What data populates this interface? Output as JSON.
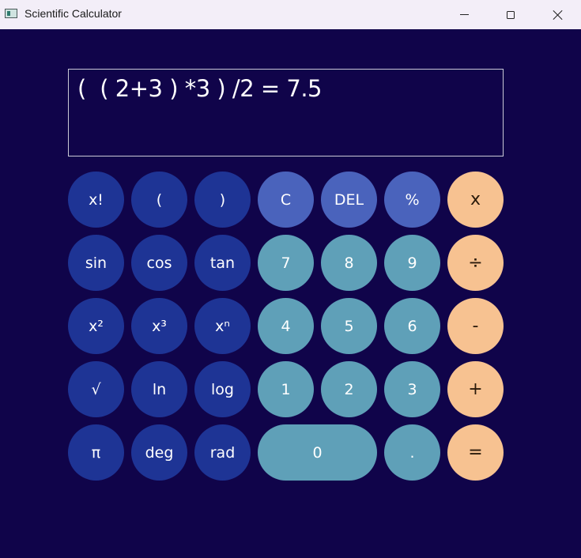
{
  "window": {
    "title": "Scientific Calculator"
  },
  "display": {
    "expression": "(  ( 2+3 ) *3 ) /2 = 7.5"
  },
  "colors": {
    "background": "#10044a",
    "function_key": "#1e3495",
    "control_key": "#4a63bc",
    "number_key": "#5fa0b8",
    "operator_key": "#f7c291"
  },
  "keys": [
    {
      "label": "x!",
      "type": "func",
      "name": "factorial-button"
    },
    {
      "label": "(",
      "type": "func",
      "name": "open-paren-button"
    },
    {
      "label": ")",
      "type": "func",
      "name": "close-paren-button"
    },
    {
      "label": "C",
      "type": "ctrl",
      "name": "clear-button"
    },
    {
      "label": "DEL",
      "type": "ctrl",
      "name": "delete-button"
    },
    {
      "label": "%",
      "type": "ctrl",
      "name": "percent-button"
    },
    {
      "label": "x",
      "type": "op",
      "name": "multiply-button"
    },
    {
      "label": "sin",
      "type": "func",
      "name": "sin-button"
    },
    {
      "label": "cos",
      "type": "func",
      "name": "cos-button"
    },
    {
      "label": "tan",
      "type": "func",
      "name": "tan-button"
    },
    {
      "label": "7",
      "type": "num",
      "name": "digit-7-button"
    },
    {
      "label": "8",
      "type": "num",
      "name": "digit-8-button"
    },
    {
      "label": "9",
      "type": "num",
      "name": "digit-9-button"
    },
    {
      "label": "÷",
      "type": "op",
      "name": "divide-button"
    },
    {
      "label": "x²",
      "type": "func",
      "name": "square-button"
    },
    {
      "label": "x³",
      "type": "func",
      "name": "cube-button"
    },
    {
      "label": "xⁿ",
      "type": "func",
      "name": "power-button"
    },
    {
      "label": "4",
      "type": "num",
      "name": "digit-4-button"
    },
    {
      "label": "5",
      "type": "num",
      "name": "digit-5-button"
    },
    {
      "label": "6",
      "type": "num",
      "name": "digit-6-button"
    },
    {
      "label": "-",
      "type": "op",
      "name": "subtract-button"
    },
    {
      "label": "√",
      "type": "func",
      "name": "sqrt-button"
    },
    {
      "label": "ln",
      "type": "func",
      "name": "ln-button"
    },
    {
      "label": "log",
      "type": "func",
      "name": "log-button"
    },
    {
      "label": "1",
      "type": "num",
      "name": "digit-1-button"
    },
    {
      "label": "2",
      "type": "num",
      "name": "digit-2-button"
    },
    {
      "label": "3",
      "type": "num",
      "name": "digit-3-button"
    },
    {
      "label": "+",
      "type": "op",
      "name": "add-button"
    },
    {
      "label": "π",
      "type": "func",
      "name": "pi-button"
    },
    {
      "label": "deg",
      "type": "func",
      "name": "deg-button"
    },
    {
      "label": "rad",
      "type": "func",
      "name": "rad-button"
    },
    {
      "label": "0",
      "type": "num",
      "name": "digit-0-button",
      "wide": true
    },
    {
      "label": ".",
      "type": "num",
      "name": "decimal-point-button"
    },
    {
      "label": "=",
      "type": "op",
      "name": "equals-button"
    }
  ]
}
